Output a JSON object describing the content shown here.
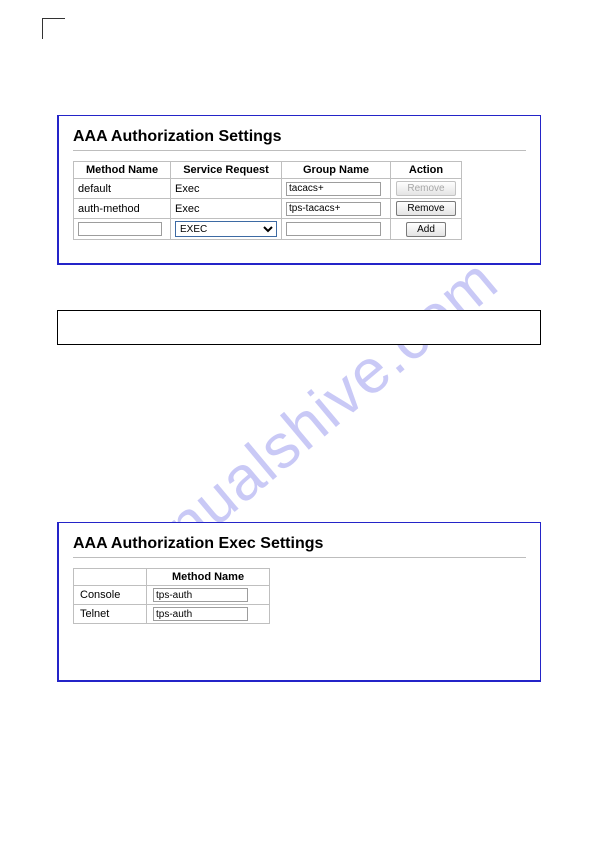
{
  "watermark": "manualshive.com",
  "panel1": {
    "title": "AAA Authorization Settings",
    "headers": [
      "Method Name",
      "Service Request",
      "Group Name",
      "Action"
    ],
    "rows": [
      {
        "method": "default",
        "service": "Exec",
        "group": "tacacs+",
        "action": "Remove",
        "disabled": true
      },
      {
        "method": "auth-method",
        "service": "Exec",
        "group": "tps-tacacs+",
        "action": "Remove",
        "disabled": false
      }
    ],
    "newRow": {
      "method": "",
      "service": "EXEC",
      "group": "",
      "action": "Add"
    }
  },
  "panel2": {
    "title": "AAA Authorization Exec Settings",
    "header": "Method Name",
    "rows": [
      {
        "label": "Console",
        "value": "tps-auth"
      },
      {
        "label": "Telnet",
        "value": "tps-auth"
      }
    ]
  }
}
